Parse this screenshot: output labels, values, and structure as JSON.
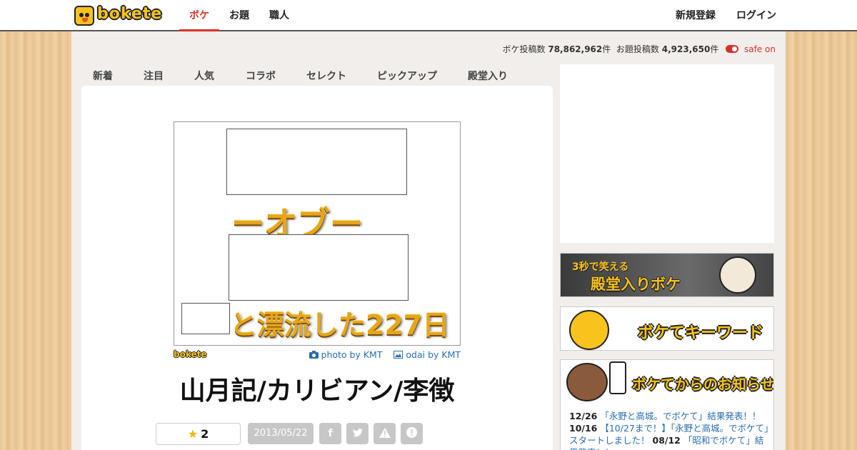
{
  "header": {
    "logo_text": "bokete",
    "nav": [
      {
        "label": "ボケ",
        "active": true
      },
      {
        "label": "お題"
      },
      {
        "label": "職人"
      }
    ],
    "signup": "新規登録",
    "login": "ログイン"
  },
  "stats": {
    "boke_label": "ボケ投稿数",
    "boke_count": "78,862,962",
    "boke_unit": "件",
    "odai_label": "お題投稿数",
    "odai_count": "4,923,650",
    "odai_unit": "件",
    "safe_label": "safe on"
  },
  "tabs": [
    "新着",
    "注目",
    "人気",
    "コラボ",
    "セレクト",
    "ピックアップ",
    "殿堂入り"
  ],
  "post": {
    "image_text_line1": "ーオブー",
    "image_text_line2": "と漂流した227日",
    "mini_logo": "bokete",
    "photo_credit": "photo by KMT",
    "odai_credit": "odai by KMT",
    "title": "山月記/カリビアン/李徴",
    "stars": "2",
    "date": "2013/05/22"
  },
  "sidebar": {
    "banner1": {
      "small": "3秒で笑える",
      "big": "殿堂入りボケ"
    },
    "banner2": {
      "big": "ボケてキーワード"
    },
    "banner3": {
      "big": "ボケてからのお知らせ"
    },
    "news": [
      {
        "date": "12/26",
        "text": "「永野と高城。でボケて」結果発表！！"
      },
      {
        "date": "10/16",
        "text": "【10/27まで！】「永野と高城。でボケて」スタートしました！"
      },
      {
        "date": "08/12",
        "text": "「昭和でボケて」結果発表！！"
      }
    ]
  },
  "colors": {
    "accent": "#d7322a",
    "link": "#2a6db0",
    "brand_yellow": "#f7c31c"
  }
}
